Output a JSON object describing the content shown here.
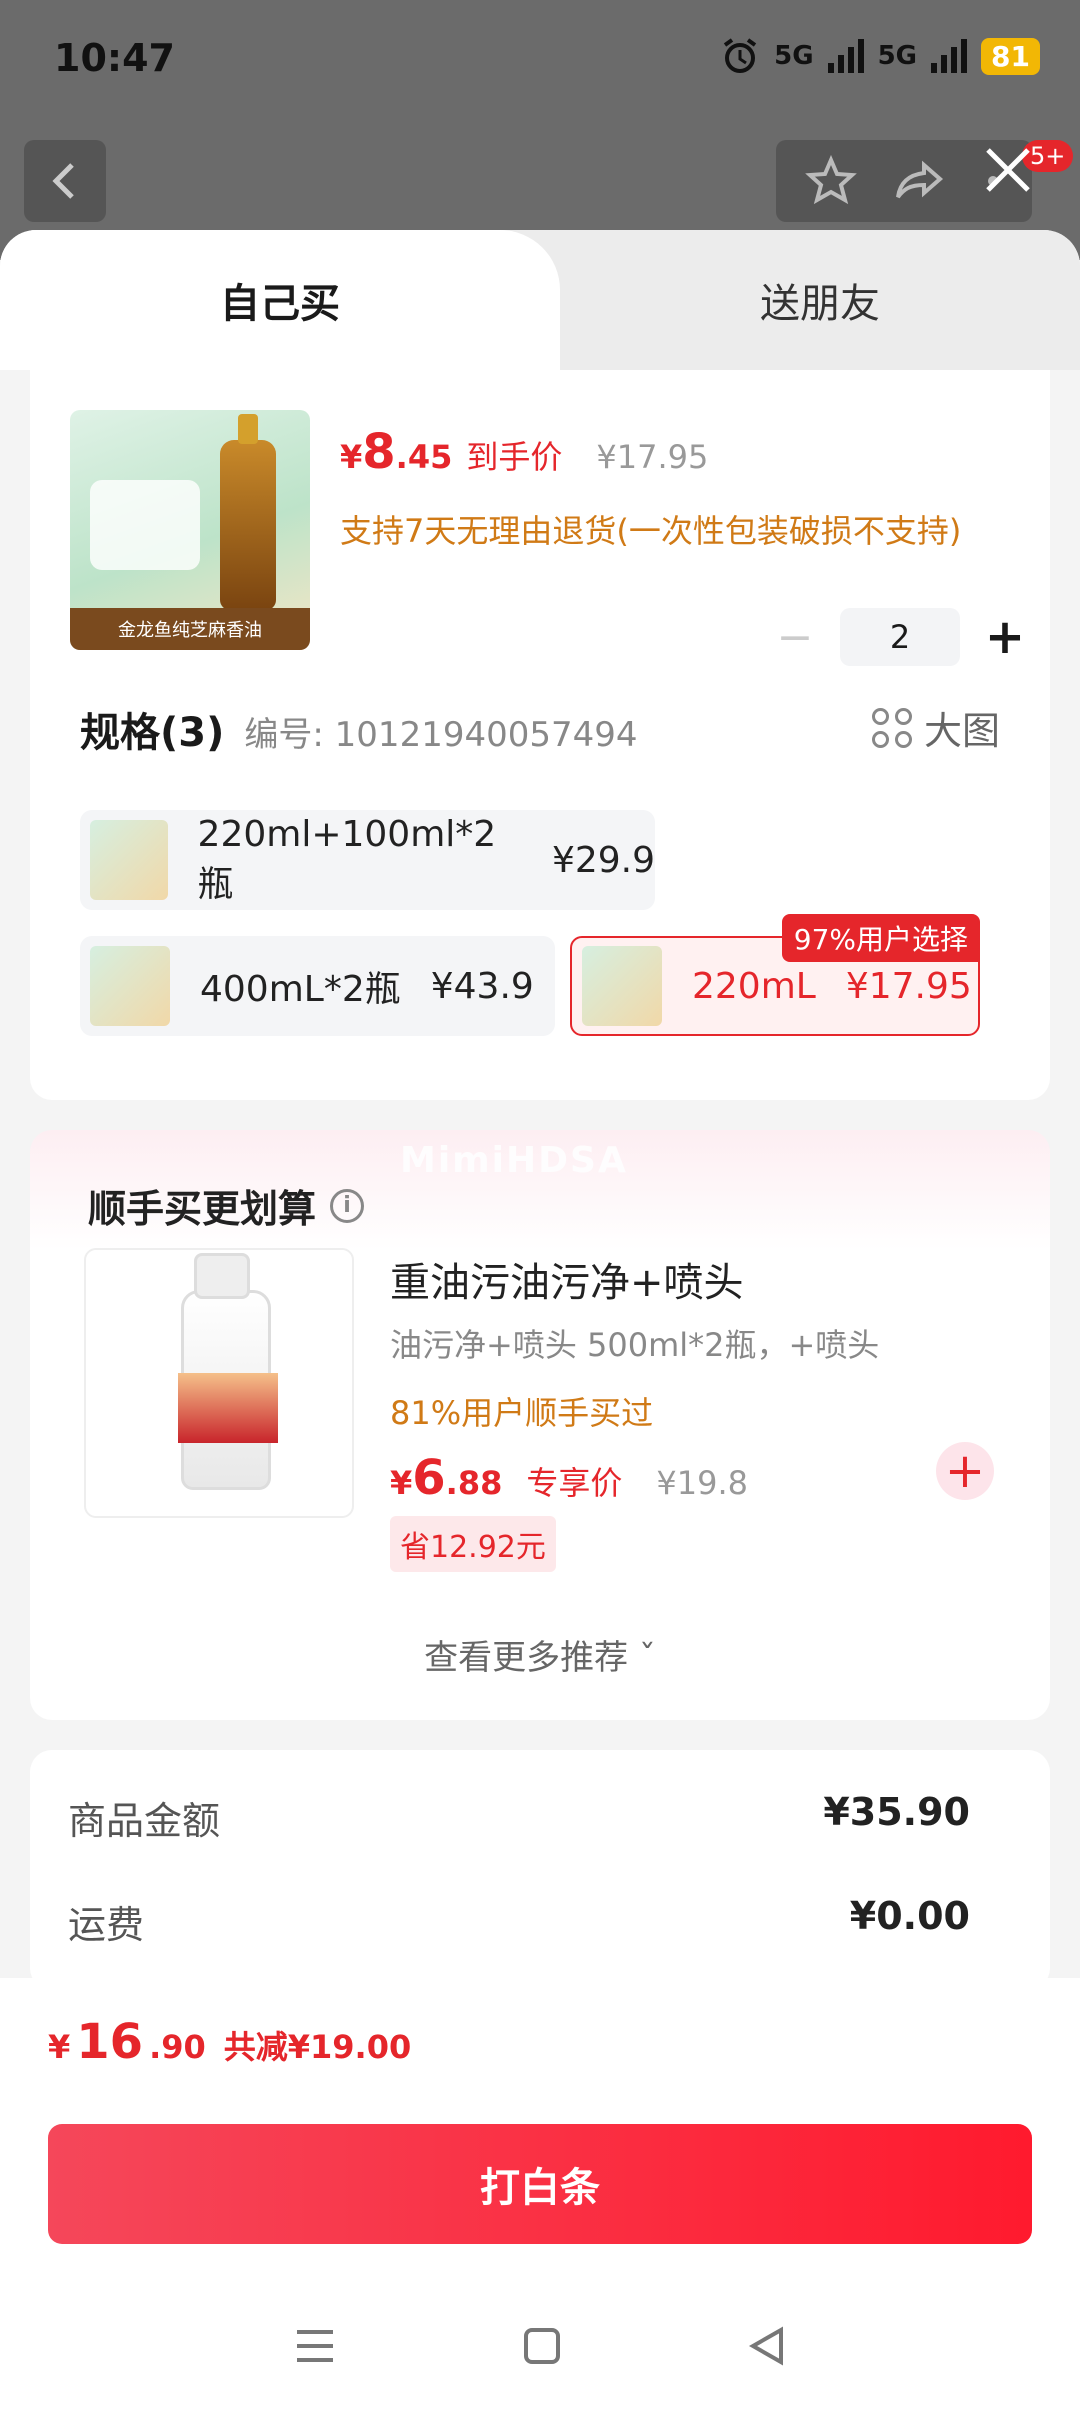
{
  "status_bar": {
    "time": "10:47",
    "network1": "5G",
    "network2": "5G",
    "battery": "81"
  },
  "background": {
    "notification_badge": "5+"
  },
  "tabs": {
    "self": "自己买",
    "friend": "送朋友"
  },
  "product": {
    "currency": "¥",
    "price_int": "8",
    "price_dec": ".45",
    "hand_price_label": "到手价",
    "original_price": "¥17.95",
    "return_policy": "支持7天无理由退货(一次性包装破损不支持)",
    "image_label": "金龙鱼纯芝麻香油",
    "quantity": "2"
  },
  "specs": {
    "title": "规格(3)",
    "number": "编号: 10121940057494",
    "big_image_label": "大图",
    "options": [
      {
        "name": "220ml+100ml*2瓶",
        "price": "¥29.9"
      },
      {
        "name": "400mL*2瓶",
        "price": "¥43.9"
      },
      {
        "name": "220mL",
        "price": "¥17.95",
        "tag": "97%用户选择"
      }
    ]
  },
  "addon": {
    "watermark": "MimiHDSA",
    "title": "顺手买更划算",
    "name": "重油污油污净+喷头",
    "desc": "油污净+喷头 500ml*2瓶，+喷头",
    "percent": "81%用户顺手买过",
    "currency": "¥",
    "price_int": "6",
    "price_dec": ".88",
    "exclusive": "专享价",
    "original": "¥19.8",
    "save": "省12.92元",
    "more": "查看更多推荐 ˇ"
  },
  "summary": {
    "goods_label": "商品金额",
    "goods_value": "¥35.90",
    "shipping_label": "运费",
    "shipping_value": "¥0.00"
  },
  "footer": {
    "currency": "¥",
    "total_int": "16",
    "total_dec": ".90",
    "reduce": "共减¥19.00",
    "pay_button": "打白条"
  },
  "colors": {
    "accent": "#e5262b",
    "orange": "#d07a16"
  }
}
